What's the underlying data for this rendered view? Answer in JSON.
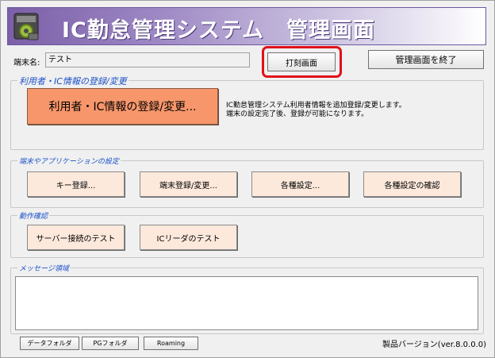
{
  "title": "IC勤怠管理システム　管理画面",
  "terminal": {
    "label": "端末名:",
    "value": "テスト"
  },
  "buttons": {
    "print_screen": "打刻画面",
    "exit_admin": "管理画面を終了",
    "user_ic_register": "利用者・IC情報の登録/変更...",
    "key_register": "キー登録...",
    "terminal_register": "端末登録/変更...",
    "settings": "各種設定...",
    "settings_check": "各種設定の確認",
    "server_test": "サーバー接続のテスト",
    "ic_reader_test": "ICリーダのテスト",
    "data_folder": "データフォルダ",
    "pg_folder": "PGフォルダ",
    "roaming": "Roaming"
  },
  "groups": {
    "user_ic": "利用者・IC情報の登録/変更",
    "terminal_app": "端末やアプリケーションの設定",
    "operation": "動作確認",
    "message": "メッセージ領域"
  },
  "description": {
    "line1": "IC勤怠管理システム利用者情報を追加登録/変更します。",
    "line2": "端末の設定完了後、登録が可能になります。"
  },
  "version": "製品バージョン(ver.8.0.0.0)",
  "colors": {
    "accent_button": "#f7966b",
    "highlight": "#e0101a",
    "group_title": "#1a50c8"
  }
}
